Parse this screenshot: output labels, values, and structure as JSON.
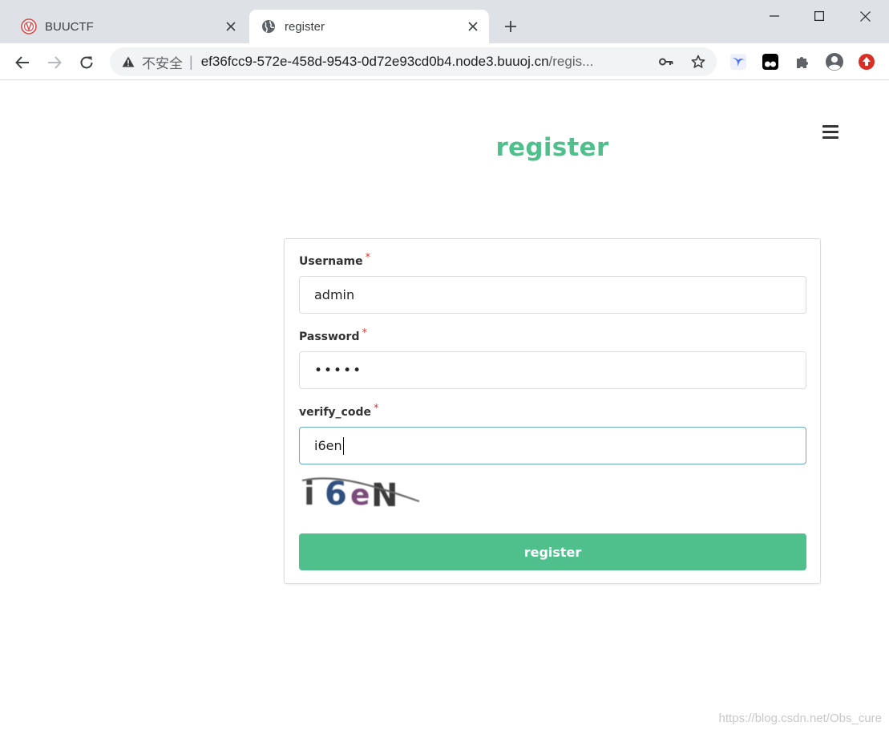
{
  "browser": {
    "tabs": [
      {
        "title": "BUUCTF",
        "active": false,
        "favicon": "buuctf-logo-icon"
      },
      {
        "title": "register",
        "active": true,
        "favicon": "globe-icon"
      }
    ],
    "new_tab_icon": "plus-icon",
    "window_controls": [
      "minimize-icon",
      "maximize-icon",
      "close-icon"
    ],
    "nav": {
      "back": "back-arrow-icon",
      "forward": "forward-arrow-icon",
      "reload": "reload-icon"
    },
    "address_bar": {
      "security_label": "不安全",
      "url_host": "ef36fcc9-572e-458d-9543-0d72e93cd0b4.node3.buuoj.cn",
      "url_rest": "/regis..."
    },
    "omnibox_icons": [
      "key-icon",
      "star-icon"
    ],
    "extension_icons": [
      "bird-extension-icon",
      "tampermonkey-icon",
      "puzzle-extensions-icon",
      "profile-avatar-icon",
      "update-icon"
    ]
  },
  "page": {
    "title": "register",
    "menu_icon": "hamburger-menu-icon",
    "form": {
      "username": {
        "label": "Username",
        "required_mark": "*",
        "value": "admin"
      },
      "password": {
        "label": "Password",
        "required_mark": "*",
        "value": "•••••"
      },
      "verify_code": {
        "label": "verify_code",
        "required_mark": "*",
        "value": "i6en"
      },
      "captcha_text": "i6eN",
      "submit_label": "register"
    }
  },
  "watermark": "https://blog.csdn.net/Obs_cure",
  "colors": {
    "accent": "#4fbf8c",
    "required": "#e53935",
    "titlebar": "#dee1e6",
    "omnibox": "#f1f3f4"
  }
}
